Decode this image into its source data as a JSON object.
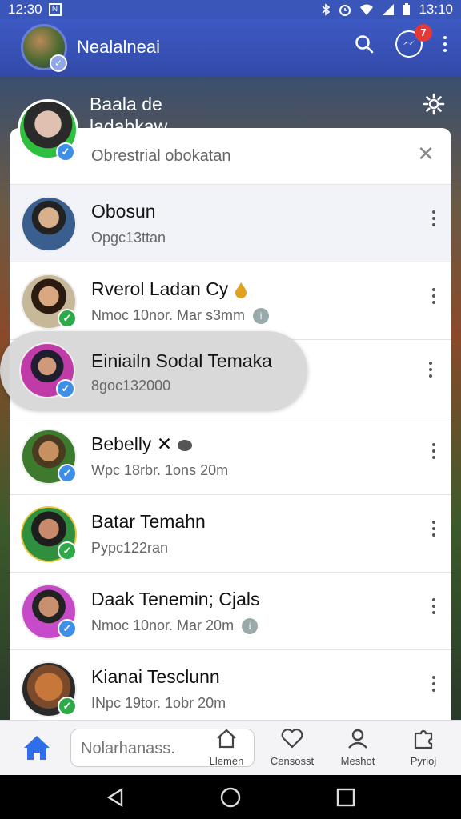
{
  "status_bar": {
    "time_left": "12:30",
    "notif_glyph": "N",
    "time_right": "13:10"
  },
  "app_bar": {
    "title": "Nealalneai",
    "notification_count": "7"
  },
  "profile_header": {
    "name_line1": "Baala de",
    "name_line2": "ladabkaw"
  },
  "search": {
    "text": "Obrestrial obokatan"
  },
  "contacts": [
    {
      "name": "Obosun",
      "status": "Opgc13ttan",
      "badge": ""
    },
    {
      "name": "Rverol Ladan Cy",
      "status": "Nmoc 10nor. Mar s3mm",
      "badge": "check"
    },
    {
      "name": "Einiailn Sodal Temaka",
      "status": "8goc132000",
      "badge": "check-blue"
    },
    {
      "name": "Bebelly ✕",
      "status": "Wpc 18rbr. 1ons 20m",
      "badge": "check-blue"
    },
    {
      "name": "Batar Temahn",
      "status": "Pypc122ran",
      "badge": "check"
    },
    {
      "name": "Daak Tenemin; Cjals",
      "status": "Nmoc 10nor. Mar 20m",
      "badge": "check-blue"
    },
    {
      "name": "Kianai Tesclunn",
      "status": "INpc 19tor. 1obr 20m",
      "badge": "check"
    }
  ],
  "bottom_nav": {
    "input_placeholder": "Nolarhanass.",
    "items": [
      {
        "label": "Llemen",
        "icon": "home-outline-icon"
      },
      {
        "label": "Censosst",
        "icon": "heart-icon"
      },
      {
        "label": "Meshot",
        "icon": "person-icon"
      },
      {
        "label": "Pyrioj",
        "icon": "puzzle-icon"
      }
    ]
  },
  "colors": {
    "accent": "#3d5ac4",
    "check_green": "#2eaa4a",
    "check_blue": "#3d8fe8",
    "notif_red": "#e53935"
  }
}
